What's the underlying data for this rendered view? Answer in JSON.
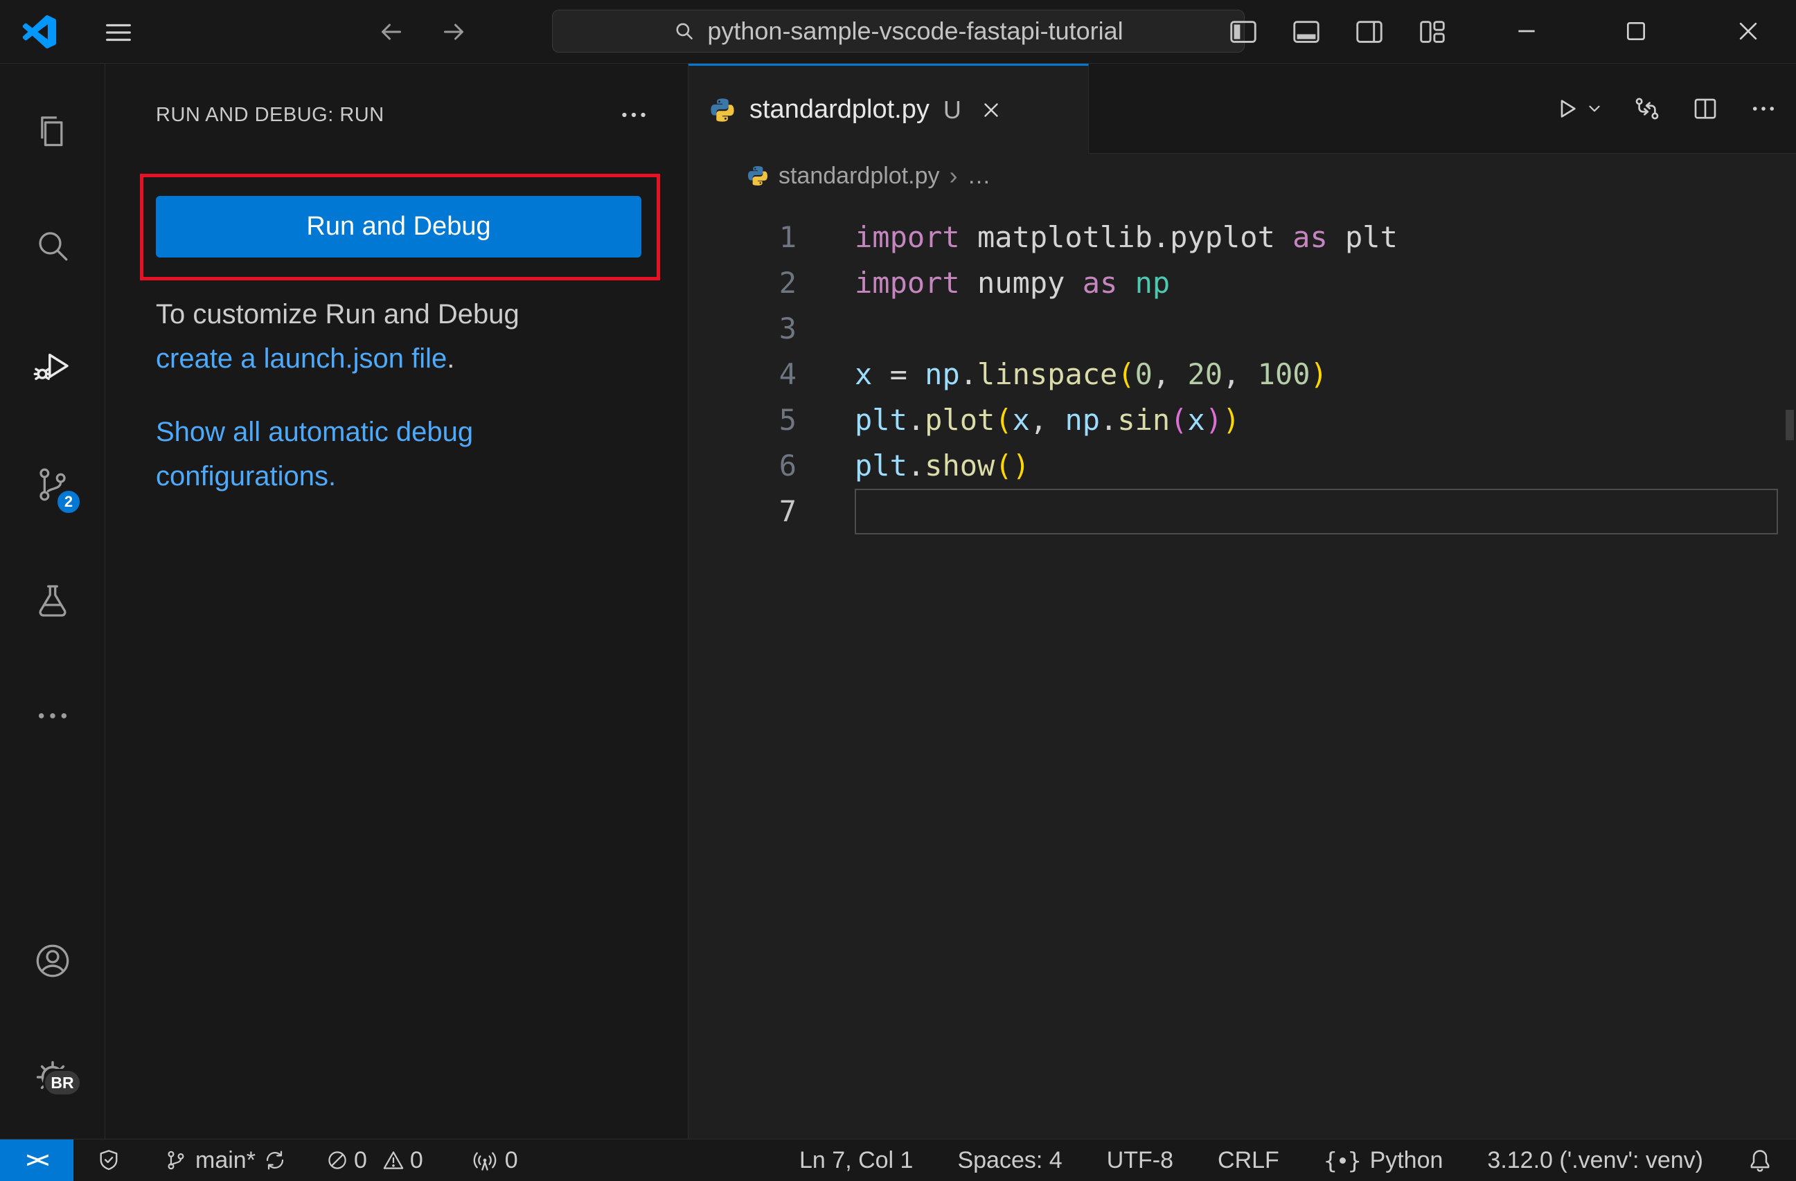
{
  "colors": {
    "accent_blue": "#0078d4",
    "annotation_red": "#e81123",
    "link_blue": "#4daafc",
    "titlebar_bg": "#181818",
    "editor_bg": "#1f1f1f"
  },
  "title_bar": {
    "search": {
      "icon": "search-icon",
      "value": "python-sample-vscode-fastapi-tutorial"
    },
    "icons": [
      "vscode-logo",
      "menu-hamburger-icon",
      "back-arrow-icon",
      "forward-arrow-icon",
      "toggle-primary-sidebar-icon",
      "toggle-panel-icon",
      "toggle-secondary-sidebar-icon",
      "customize-layout-icon",
      "minimize-icon",
      "maximize-icon",
      "close-icon"
    ]
  },
  "activity_bar": {
    "items": [
      "explorer",
      "search",
      "run-and-debug",
      "source-control",
      "testing",
      "more"
    ],
    "bottom_items": [
      "accounts",
      "settings"
    ],
    "active_item": "run-and-debug",
    "scm_badge": "2",
    "profile_badge": "BR"
  },
  "sidebar": {
    "header": "RUN AND DEBUG: RUN",
    "run_button": "Run and Debug",
    "customize_line": "To customize Run and Debug",
    "launch_link": "create a launch.json file",
    "launch_suffix": ".",
    "show_all_link": "Show all automatic debug configurations."
  },
  "editor": {
    "tab": {
      "filename": "standardplot.py",
      "git_status": "U"
    },
    "breadcrumb": {
      "file": "standardplot.py",
      "separator": "›",
      "more": "…"
    },
    "toolbar_icons": [
      "run-icon",
      "run-dropdown-icon",
      "open-changes-icon",
      "split-editor-icon",
      "more-actions-icon"
    ],
    "code": {
      "language": "python",
      "lines": [
        {
          "num": "1",
          "tokens": [
            {
              "t": "import",
              "s": "kw"
            },
            {
              "t": " matplotlib.pyplot ",
              "s": "pl"
            },
            {
              "t": "as",
              "s": "kw"
            },
            {
              "t": " plt",
              "s": "pl"
            }
          ]
        },
        {
          "num": "2",
          "tokens": [
            {
              "t": "import",
              "s": "kw"
            },
            {
              "t": " numpy ",
              "s": "pl"
            },
            {
              "t": "as",
              "s": "kw"
            },
            {
              "t": " np",
              "s": "mod"
            }
          ]
        },
        {
          "num": "3",
          "tokens": []
        },
        {
          "num": "4",
          "tokens": [
            {
              "t": "x",
              "s": "var"
            },
            {
              "t": " = ",
              "s": "pl"
            },
            {
              "t": "np",
              "s": "var"
            },
            {
              "t": ".",
              "s": "pl"
            },
            {
              "t": "linspace",
              "s": "fn"
            },
            {
              "t": "(",
              "s": "p1"
            },
            {
              "t": "0",
              "s": "num"
            },
            {
              "t": ", ",
              "s": "pl"
            },
            {
              "t": "20",
              "s": "num"
            },
            {
              "t": ", ",
              "s": "pl"
            },
            {
              "t": "100",
              "s": "num"
            },
            {
              "t": ")",
              "s": "p1"
            }
          ]
        },
        {
          "num": "5",
          "tokens": [
            {
              "t": "plt",
              "s": "var"
            },
            {
              "t": ".",
              "s": "pl"
            },
            {
              "t": "plot",
              "s": "fn"
            },
            {
              "t": "(",
              "s": "p1"
            },
            {
              "t": "x",
              "s": "var"
            },
            {
              "t": ", ",
              "s": "pl"
            },
            {
              "t": "np",
              "s": "var"
            },
            {
              "t": ".",
              "s": "pl"
            },
            {
              "t": "sin",
              "s": "fn"
            },
            {
              "t": "(",
              "s": "p2"
            },
            {
              "t": "x",
              "s": "var"
            },
            {
              "t": ")",
              "s": "p2"
            },
            {
              "t": ")",
              "s": "p1"
            }
          ]
        },
        {
          "num": "6",
          "tokens": [
            {
              "t": "plt",
              "s": "var"
            },
            {
              "t": ".",
              "s": "pl"
            },
            {
              "t": "show",
              "s": "fn"
            },
            {
              "t": "()",
              "s": "p1"
            }
          ]
        },
        {
          "num": "7",
          "tokens": [],
          "active": true
        }
      ]
    }
  },
  "status_bar": {
    "remote_label": "><",
    "branch": "main*",
    "errors": "0",
    "warnings": "0",
    "ports": "0",
    "cursor_position": "Ln 7, Col 1",
    "indentation": "Spaces: 4",
    "encoding": "UTF-8",
    "eol": "CRLF",
    "language": "Python",
    "interpreter": "3.12.0 ('.venv': venv)"
  }
}
